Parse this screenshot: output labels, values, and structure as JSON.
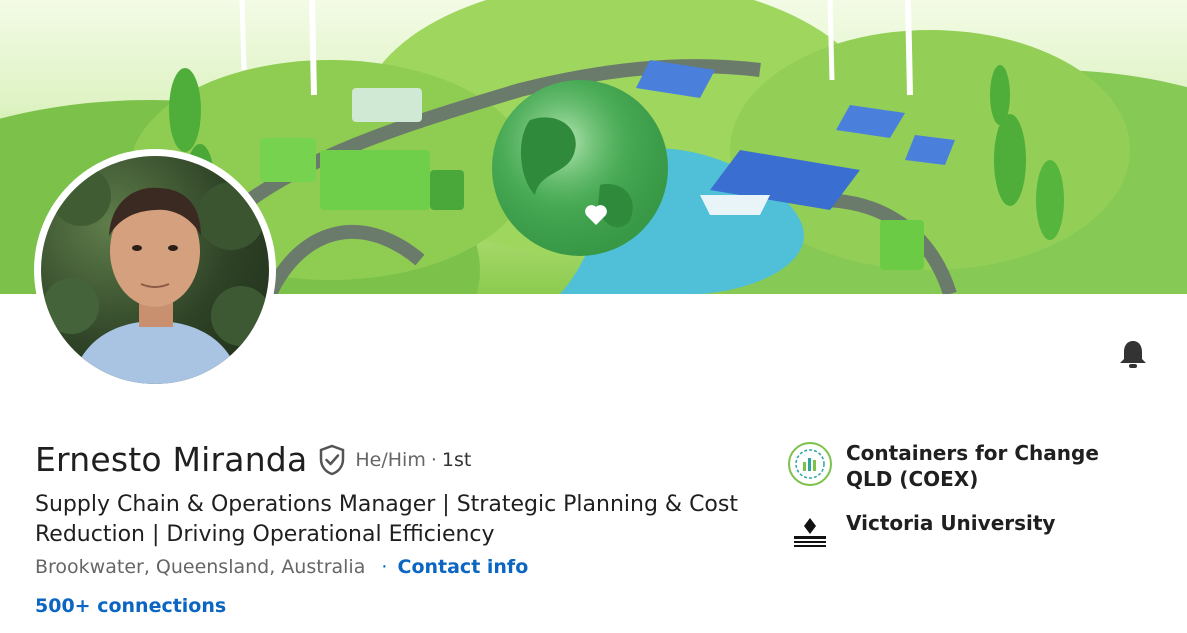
{
  "profile": {
    "name": "Ernesto Miranda",
    "pronouns": "He/Him",
    "separator": "·",
    "degree": "1st",
    "headline": "Supply Chain & Operations Manager | Strategic Planning & Cost Reduction | Driving Operational Efficiency",
    "location": "Brookwater, Queensland, Australia",
    "contact_dot": "·",
    "contact_label": "Contact info",
    "connections": "500+ connections"
  },
  "organizations": [
    {
      "name": "Containers for Change QLD (COEX)",
      "logo_text": "CONTAINERS FOR CHANGE",
      "logo_icon": "containers-for-change-logo"
    },
    {
      "name": "Victoria University",
      "logo_text": "VICTORIA UNIVERSITY",
      "logo_icon": "victoria-university-logo"
    }
  ],
  "icons": {
    "bell": "bell-icon",
    "verified": "verified-shield-icon"
  },
  "colors": {
    "link": "#0a66c2",
    "text": "#1f1f1f",
    "muted": "#666666",
    "banner_green": "#8ccb4f"
  }
}
